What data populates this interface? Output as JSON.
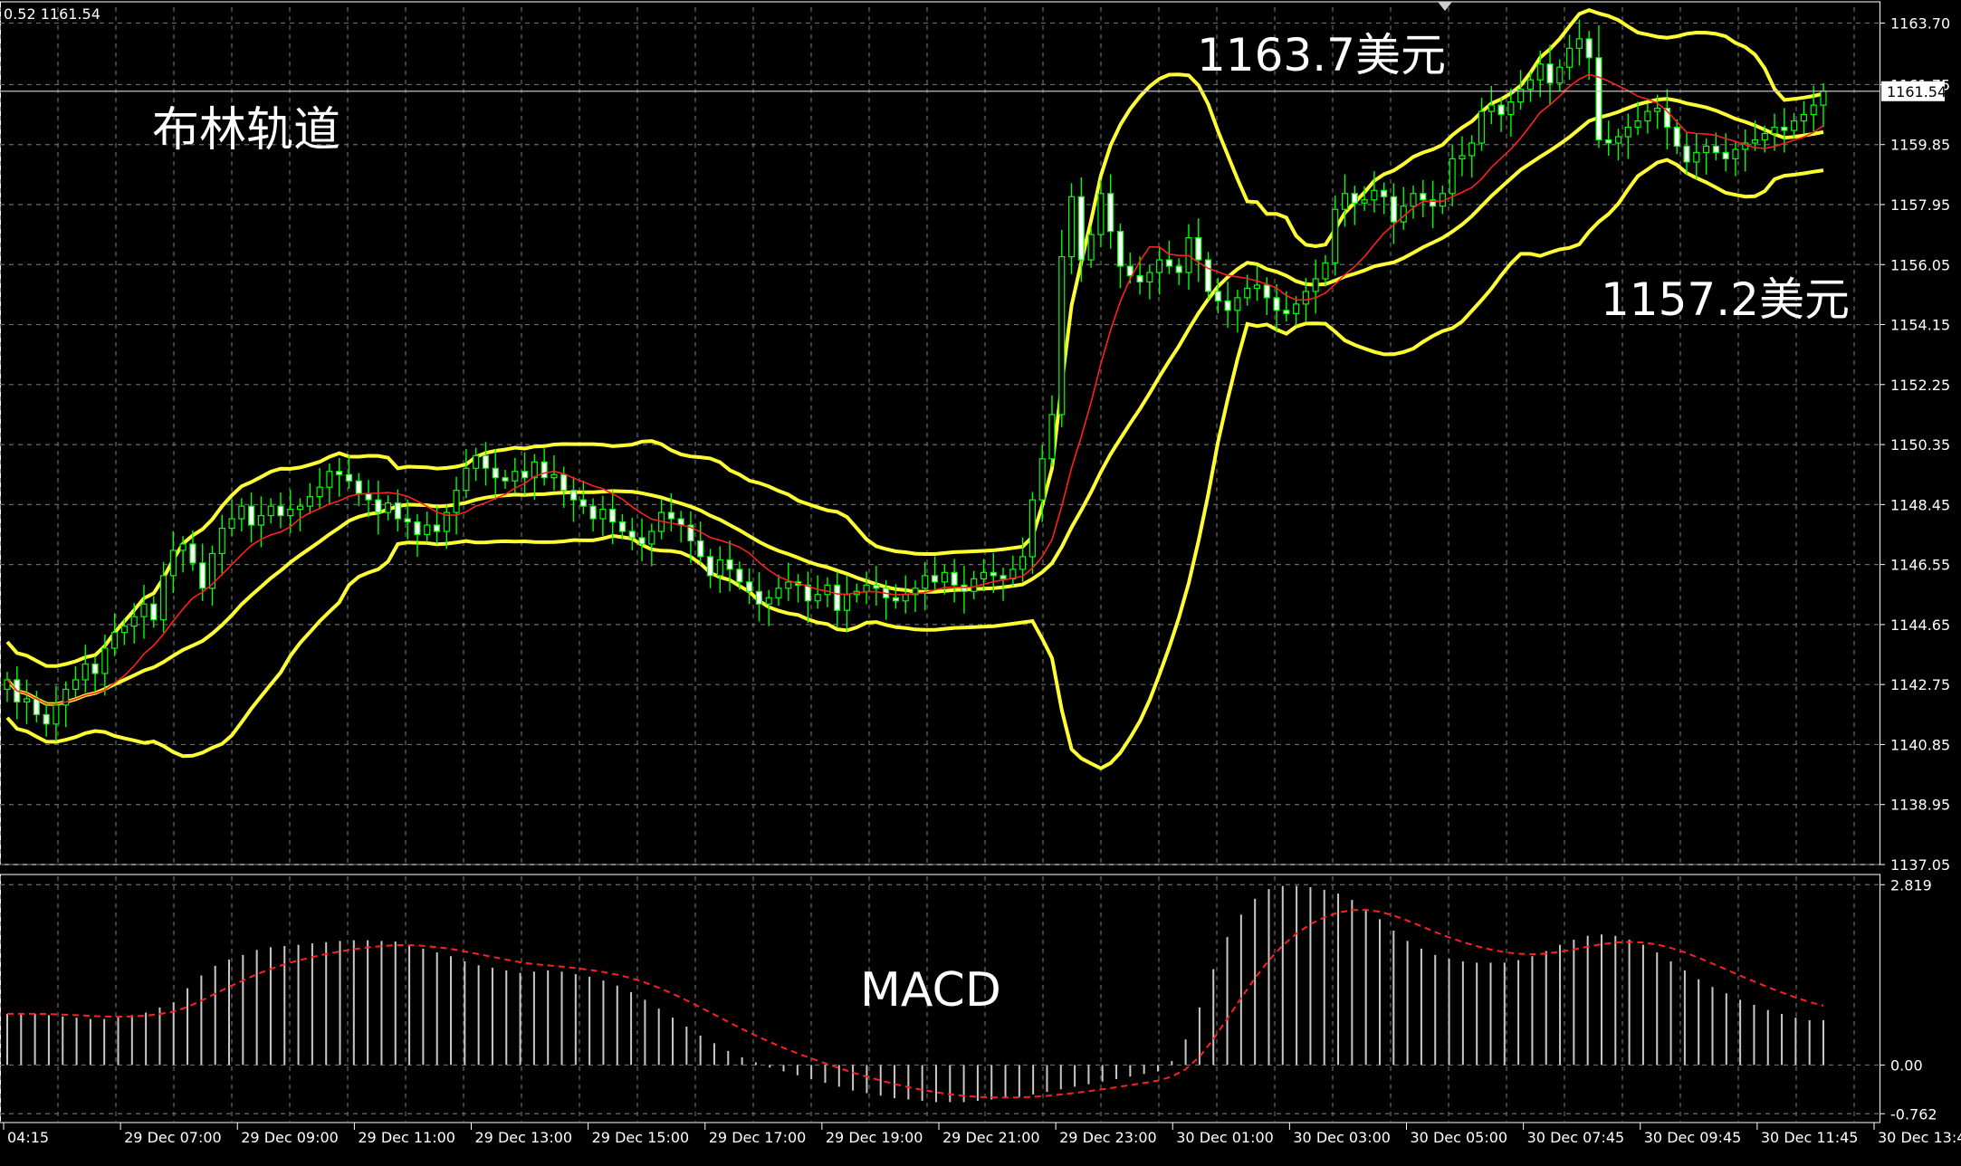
{
  "header": {
    "ohlc_readout": "0.52 1161.54"
  },
  "annotations": {
    "title": "布林轨道",
    "upper_label": "1163.7美元",
    "lower_label": "1157.2美元",
    "macd_label": "MACD"
  },
  "current_price_label": "1161.54",
  "colors": {
    "background": "#000000",
    "grid": "#6b6b6b",
    "axis_text": "#ffffff",
    "candle_up": "#00ff00",
    "candle_down_body": "#ffffff",
    "bollinger": "#ffff33",
    "moving_average": "#ff2020",
    "macd_histogram": "#c8c8c8",
    "macd_signal": "#ff2020",
    "price_line": "#c0c0c0"
  },
  "chart_data": [
    {
      "type": "candlestick",
      "subtype": "price chart with Bollinger Bands",
      "y_ticks": [
        "1163.70",
        "1161.75",
        "1159.85",
        "1157.95",
        "1156.05",
        "1154.15",
        "1152.25",
        "1150.35",
        "1148.45",
        "1146.55",
        "1144.65",
        "1142.75",
        "1140.85",
        "1138.95",
        "1137.05"
      ],
      "ylim": [
        1137.05,
        1164.2
      ],
      "x_ticks": [
        "04:15",
        "29 Dec 07:00",
        "29 Dec 09:00",
        "29 Dec 11:00",
        "29 Dec 13:00",
        "29 Dec 15:00",
        "29 Dec 17:00",
        "29 Dec 19:00",
        "29 Dec 21:00",
        "29 Dec 23:00",
        "30 Dec 01:00",
        "30 Dec 03:00",
        "30 Dec 05:00",
        "30 Dec 07:45",
        "30 Dec 09:45",
        "30 Dec 11:45",
        "30 Dec 13:45"
      ],
      "current_price": 1161.54,
      "grid": true,
      "closes": [
        1142.9,
        1142.2,
        1142.3,
        1141.8,
        1141.5,
        1142.1,
        1142.6,
        1142.9,
        1143.4,
        1143.1,
        1143.9,
        1144.4,
        1144.6,
        1144.9,
        1145.3,
        1144.8,
        1146.2,
        1147.0,
        1147.2,
        1146.6,
        1145.8,
        1146.9,
        1147.7,
        1148.0,
        1148.4,
        1147.8,
        1148.1,
        1148.4,
        1148.1,
        1148.3,
        1148.4,
        1148.7,
        1149.0,
        1149.5,
        1149.4,
        1149.2,
        1148.8,
        1148.6,
        1148.2,
        1148.5,
        1148.0,
        1147.9,
        1147.5,
        1147.8,
        1147.6,
        1148.2,
        1148.9,
        1149.6,
        1150.0,
        1149.6,
        1149.3,
        1149.2,
        1149.5,
        1149.3,
        1149.8,
        1149.3,
        1149.4,
        1148.9,
        1148.6,
        1148.4,
        1148.0,
        1148.3,
        1147.9,
        1147.6,
        1147.4,
        1147.2,
        1147.6,
        1148.2,
        1148.0,
        1147.8,
        1147.3,
        1146.8,
        1146.2,
        1146.7,
        1146.4,
        1146.0,
        1145.7,
        1145.3,
        1145.5,
        1145.8,
        1146.0,
        1145.9,
        1145.4,
        1145.6,
        1145.9,
        1145.1,
        1145.6,
        1145.7,
        1145.9,
        1145.8,
        1145.5,
        1145.4,
        1145.6,
        1145.8,
        1146.2,
        1146.0,
        1146.3,
        1145.9,
        1145.7,
        1146.1,
        1146.3,
        1146.2,
        1146.1,
        1146.4,
        1146.8,
        1148.6,
        1149.9,
        1151.3,
        1156.3,
        1158.2,
        1156.2,
        1157.0,
        1158.3,
        1157.1,
        1156.0,
        1155.7,
        1155.5,
        1155.8,
        1156.2,
        1156.0,
        1155.8,
        1156.9,
        1156.2,
        1155.2,
        1154.9,
        1154.6,
        1155.0,
        1155.3,
        1155.4,
        1155.0,
        1154.6,
        1154.5,
        1154.8,
        1155.2,
        1155.6,
        1156.1,
        1157.8,
        1158.3,
        1158.0,
        1158.1,
        1158.4,
        1158.2,
        1157.4,
        1157.9,
        1158.3,
        1158.1,
        1157.9,
        1158.3,
        1159.4,
        1159.5,
        1159.9,
        1160.9,
        1161.1,
        1160.8,
        1161.2,
        1161.6,
        1161.9,
        1162.4,
        1161.8,
        1162.3,
        1162.9,
        1163.2,
        1162.6,
        1160.0,
        1159.9,
        1160.1,
        1160.4,
        1160.6,
        1160.9,
        1161.0,
        1160.4,
        1159.8,
        1159.3,
        1159.6,
        1159.8,
        1159.6,
        1159.4,
        1159.7,
        1159.9,
        1160.0,
        1160.2,
        1160.4,
        1160.3,
        1160.6,
        1160.8,
        1161.1,
        1161.54
      ]
    },
    {
      "type": "bar",
      "subtype": "MACD histogram with signal line",
      "y_ticks": [
        "2.819",
        "0.00",
        "-0.762"
      ],
      "ylim": [
        -0.9,
        2.95
      ],
      "histogram": [
        0.8,
        0.8,
        0.8,
        0.78,
        0.76,
        0.74,
        0.72,
        0.72,
        0.74,
        0.78,
        0.82,
        0.9,
        0.98,
        1.2,
        1.4,
        1.55,
        1.65,
        1.72,
        1.8,
        1.84,
        1.86,
        1.88,
        1.9,
        1.92,
        1.94,
        1.95,
        1.95,
        1.94,
        1.93,
        1.88,
        1.82,
        1.76,
        1.7,
        1.62,
        1.56,
        1.52,
        1.48,
        1.44,
        1.46,
        1.48,
        1.46,
        1.42,
        1.38,
        1.32,
        1.24,
        1.14,
        1.02,
        0.88,
        0.74,
        0.6,
        0.46,
        0.34,
        0.22,
        0.12,
        0.04,
        -0.04,
        -0.1,
        -0.16,
        -0.22,
        -0.28,
        -0.34,
        -0.4,
        -0.44,
        -0.48,
        -0.52,
        -0.54,
        -0.56,
        -0.58,
        -0.58,
        -0.58,
        -0.56,
        -0.54,
        -0.52,
        -0.5,
        -0.46,
        -0.42,
        -0.38,
        -0.34,
        -0.3,
        -0.26,
        -0.22,
        -0.18,
        -0.14,
        -0.1,
        0.06,
        0.4,
        0.9,
        1.5,
        2.0,
        2.35,
        2.6,
        2.75,
        2.8,
        2.8,
        2.78,
        2.74,
        2.68,
        2.58,
        2.44,
        2.28,
        2.1,
        1.94,
        1.82,
        1.72,
        1.66,
        1.62,
        1.6,
        1.6,
        1.6,
        1.64,
        1.7,
        1.78,
        1.88,
        1.96,
        2.02,
        2.04,
        2.02,
        1.96,
        1.88,
        1.76,
        1.62,
        1.48,
        1.34,
        1.22,
        1.12,
        1.02,
        0.94,
        0.86,
        0.8,
        0.74,
        0.7,
        0.7
      ],
      "signal_note": "red dashed signal line"
    }
  ]
}
